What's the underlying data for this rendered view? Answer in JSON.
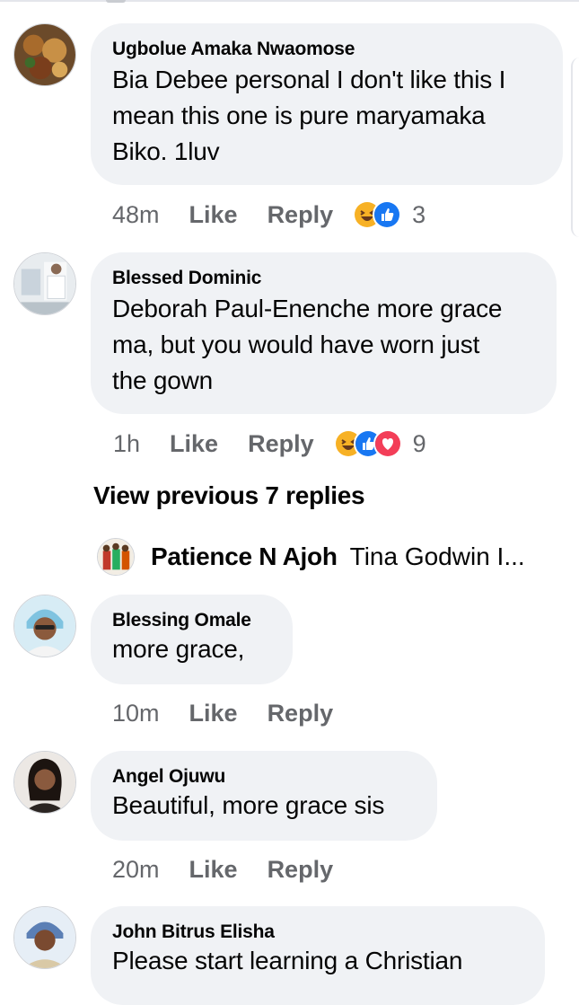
{
  "comments": [
    {
      "author": "Ugbolue Amaka Nwaomose",
      "lines": [
        "Bia Debee personal I don't like this I",
        "mean this one is pure maryamaka",
        "Biko. 1luv"
      ],
      "time": "48m",
      "like": "Like",
      "reply": "Reply",
      "reactions": [
        "haha",
        "like"
      ],
      "reaction_count": "3"
    },
    {
      "author": "Blessed Dominic",
      "lines": [
        "Deborah Paul-Enenche more grace",
        "ma, but you would have worn just",
        "the gown"
      ],
      "time": "1h",
      "like": "Like",
      "reply": "Reply",
      "reactions": [
        "haha",
        "like",
        "love"
      ],
      "reaction_count": "9"
    },
    {
      "author": "Blessing Omale",
      "lines": [
        "more grace,"
      ],
      "time": "10m",
      "like": "Like",
      "reply": "Reply"
    },
    {
      "author": "Angel Ojuwu",
      "lines": [
        "Beautiful, more grace sis"
      ],
      "time": "20m",
      "like": "Like",
      "reply": "Reply"
    },
    {
      "author": "John Bitrus Elisha",
      "lines": [
        "Please start learning a Christian"
      ]
    }
  ],
  "view_previous": "View previous 7 replies",
  "reply_preview": {
    "name": "Patience N Ajoh",
    "text": "Tina Godwin I..."
  },
  "colors": {
    "bubble": "#f0f2f5",
    "meta_text": "#65676b",
    "like_blue": "#1877f2",
    "love_red": "#f33e58",
    "haha_yellow": "#f7b125"
  },
  "icons": [
    "haha-reaction-icon",
    "like-reaction-icon",
    "love-reaction-icon"
  ]
}
